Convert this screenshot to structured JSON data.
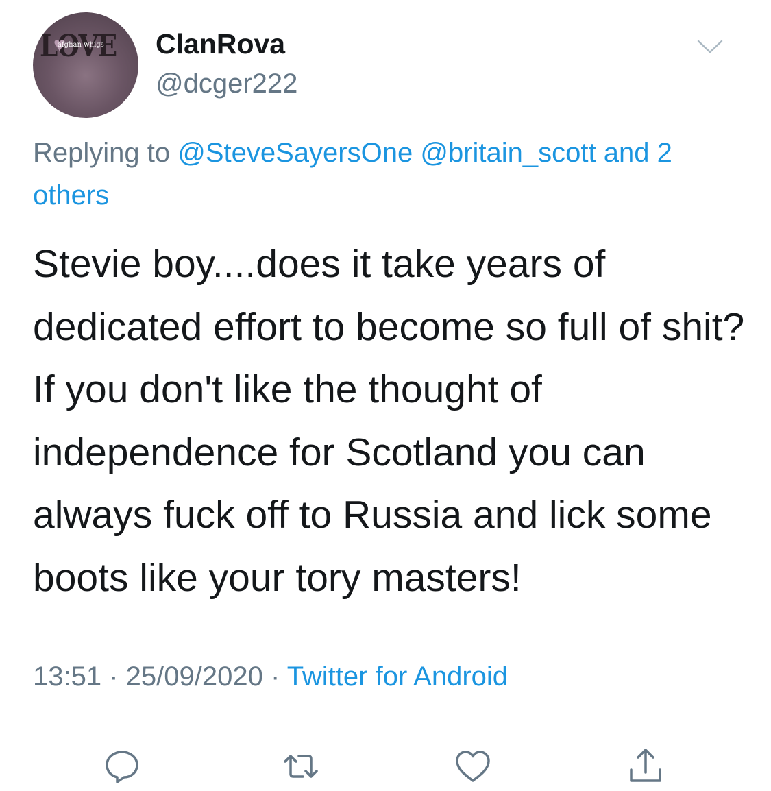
{
  "tweet": {
    "avatar": {
      "logo_text": "LOVE",
      "band_text": "afghan whigs"
    },
    "author": {
      "display_name": "ClanRova",
      "handle": "@dcger222"
    },
    "replying": {
      "prefix": "Replying to ",
      "mention_1": "@SteveSayersOne",
      "mention_2": "@britain_scott",
      "and_others": "and 2 others"
    },
    "text": "Stevie boy....does it take years of dedicated effort to become so full of shit? If you don't like the thought of independence for Scotland you can always fuck off to Russia and lick some boots like your tory masters!",
    "meta": {
      "time": "13:51",
      "separator": " · ",
      "date": "25/09/2020",
      "source": "Twitter for Android"
    }
  },
  "icons": {
    "menu": "chevron-down-icon",
    "reply": "reply-icon",
    "retweet": "retweet-icon",
    "like": "heart-icon",
    "share": "share-icon"
  },
  "colors": {
    "text": "#14171a",
    "secondary": "#657786",
    "link": "#1b95e0",
    "divider": "#e1e8ed"
  }
}
